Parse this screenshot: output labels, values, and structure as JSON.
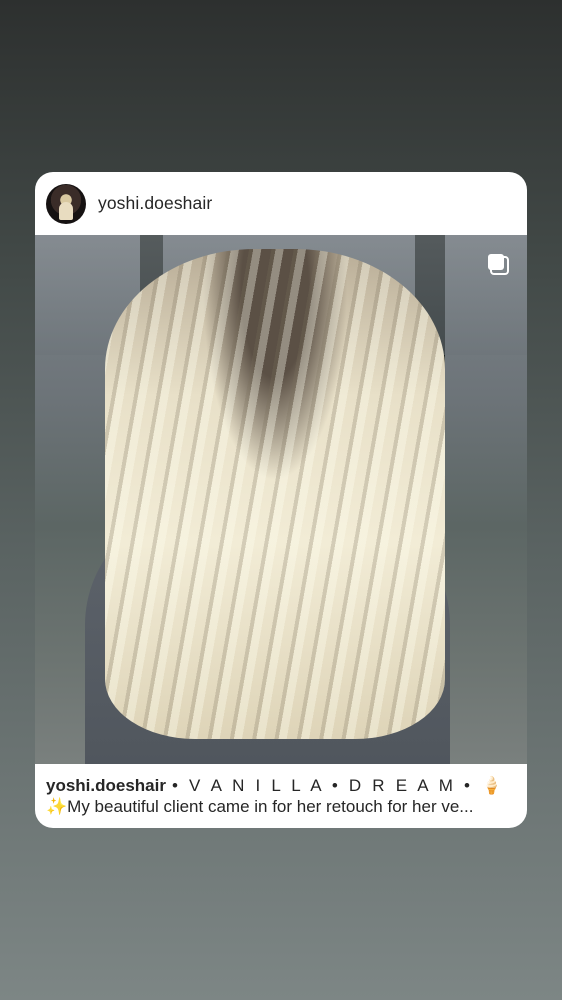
{
  "post": {
    "username": "yoshi.doeshair",
    "caption": {
      "username": "yoshi.doeshair",
      "title": "• V A N I L L A • D R E A M • 🍦",
      "body": "✨My beautiful client came in for her retouch for her ve..."
    },
    "icons": {
      "avatar": "profile-avatar",
      "multi_post": "carousel-stack-icon"
    }
  }
}
